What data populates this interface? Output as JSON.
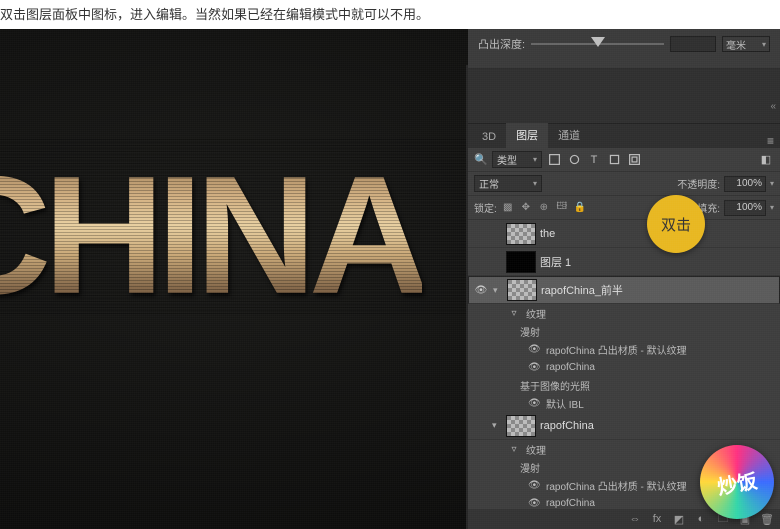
{
  "caption": "双击图层面板中图标，进入编辑。当然如果已经在编辑模式中就可以不用。",
  "canvas_text": "CHINA",
  "depth": {
    "label": "凸出深度:",
    "value": "",
    "unit": "毫米"
  },
  "panel": {
    "tabs": [
      "3D",
      "图层",
      "通道"
    ],
    "active_tab": 1,
    "filter_label": "类型",
    "blend_mode": "正常",
    "opacity_label": "不透明度:",
    "opacity_value": "100%",
    "lock_label": "锁定:",
    "fill_label": "填充:",
    "fill_value": "100%"
  },
  "layers": [
    {
      "name": "the"
    },
    {
      "name": "图层 1"
    },
    {
      "name": "rapofChina_前半",
      "selected": true,
      "children": {
        "texture_label": "纹理",
        "diffuse_label": "漫射",
        "items": [
          "rapofChina 凸出材质 - 默认纹理",
          "rapofChina"
        ],
        "ibl_label": "基于图像的光照",
        "ibl_item": "默认 IBL"
      }
    },
    {
      "name": "rapofChina",
      "children": {
        "texture_label": "纹理",
        "diffuse_label": "漫射",
        "items": [
          "rapofChina 凸出材质 - 默认纹理",
          "rapofChina"
        ]
      }
    }
  ],
  "tooltip": "双击",
  "logo_text": "炒饭"
}
